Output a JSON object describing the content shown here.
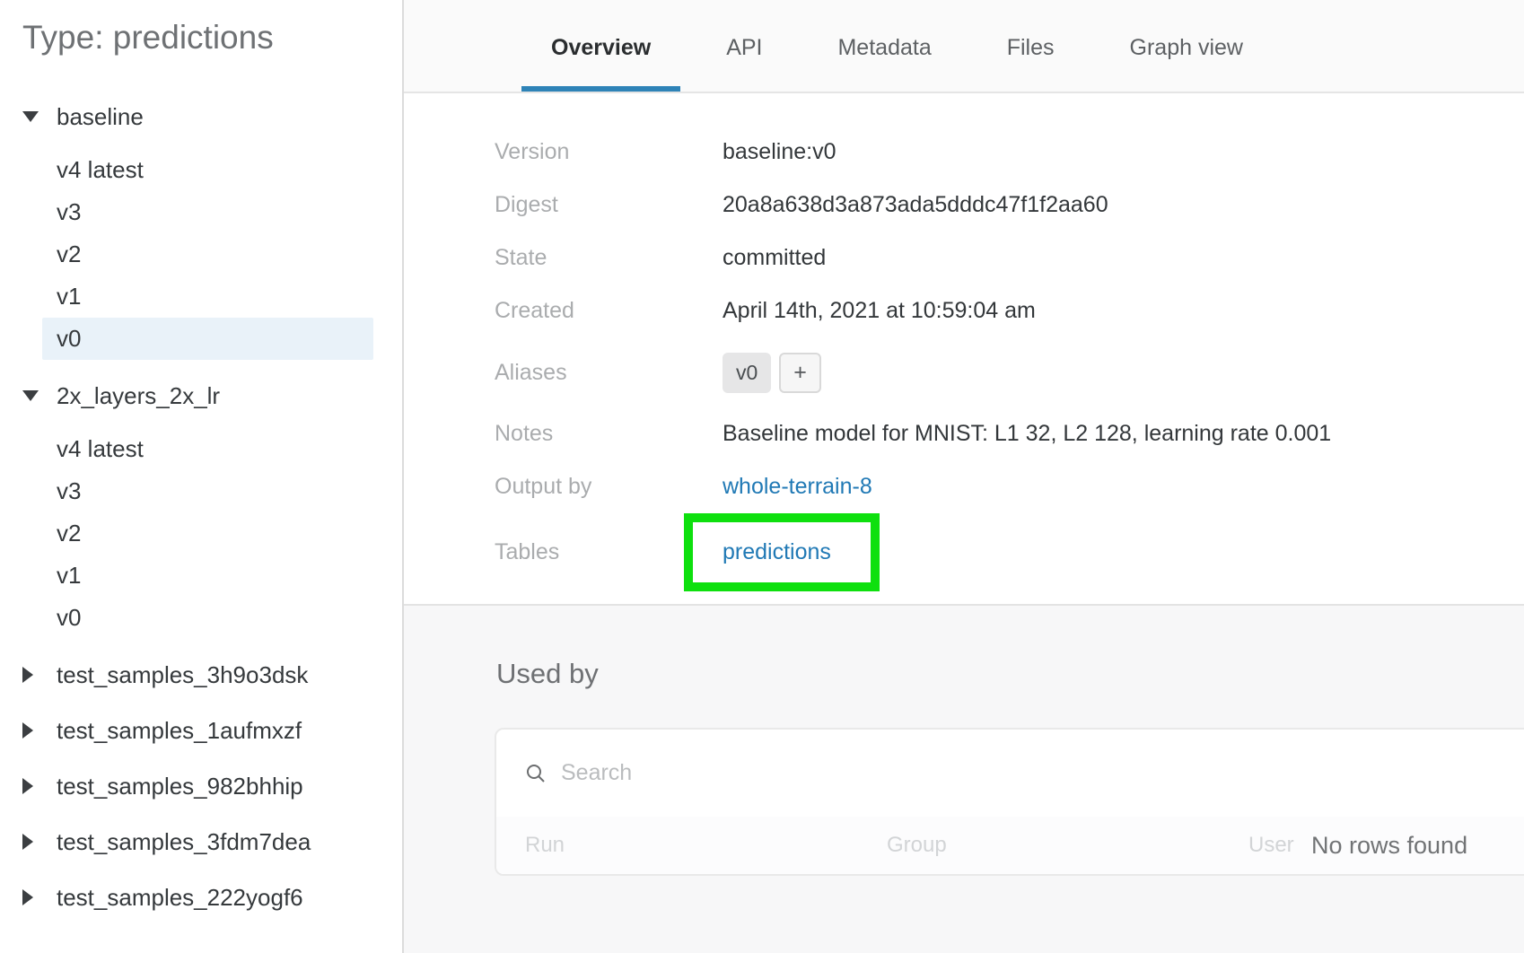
{
  "colors": {
    "accent_blue": "#2e83b7",
    "link_blue": "#2079b5",
    "highlight_green": "#0ee00e",
    "selected_row_bg": "#e9f2f9"
  },
  "sidebar": {
    "title": "Type: predictions",
    "tree": [
      {
        "type": "group",
        "label": "baseline",
        "expanded": true
      },
      {
        "type": "version",
        "label": "v4 latest",
        "selected": false
      },
      {
        "type": "version",
        "label": "v3",
        "selected": false
      },
      {
        "type": "version",
        "label": "v2",
        "selected": false
      },
      {
        "type": "version",
        "label": "v1",
        "selected": false
      },
      {
        "type": "version",
        "label": "v0",
        "selected": true
      },
      {
        "type": "group",
        "label": "2x_layers_2x_lr",
        "expanded": true
      },
      {
        "type": "version",
        "label": "v4 latest",
        "selected": false
      },
      {
        "type": "version",
        "label": "v3",
        "selected": false
      },
      {
        "type": "version",
        "label": "v2",
        "selected": false
      },
      {
        "type": "version",
        "label": "v1",
        "selected": false
      },
      {
        "type": "version",
        "label": "v0",
        "selected": false
      },
      {
        "type": "group",
        "label": "test_samples_3h9o3dsk",
        "expanded": false
      },
      {
        "type": "group",
        "label": "test_samples_1aufmxzf",
        "expanded": false
      },
      {
        "type": "group",
        "label": "test_samples_982bhhip",
        "expanded": false
      },
      {
        "type": "group",
        "label": "test_samples_3fdm7dea",
        "expanded": false
      },
      {
        "type": "group",
        "label": "test_samples_222yogf6",
        "expanded": false
      }
    ]
  },
  "tabs": {
    "items": [
      {
        "label": "Overview",
        "active": true
      },
      {
        "label": "API",
        "active": false
      },
      {
        "label": "Metadata",
        "active": false
      },
      {
        "label": "Files",
        "active": false
      },
      {
        "label": "Graph view",
        "active": false
      }
    ]
  },
  "overview": {
    "fields": [
      {
        "label": "Version",
        "type": "text",
        "value": "baseline:v0"
      },
      {
        "label": "Digest",
        "type": "text",
        "value": "20a8a638d3a873ada5dddc47f1f2aa60"
      },
      {
        "label": "State",
        "type": "text",
        "value": "committed"
      },
      {
        "label": "Created",
        "type": "text",
        "value": "April 14th, 2021 at 10:59:04 am"
      },
      {
        "label": "Aliases",
        "type": "aliases",
        "pills": [
          "v0"
        ],
        "add_label": "+"
      },
      {
        "label": "Notes",
        "type": "text",
        "value": "Baseline model for MNIST: L1 32, L2 128, learning rate 0.001"
      },
      {
        "label": "Output by",
        "type": "link",
        "value": "whole-terrain-8",
        "highlighted": false
      },
      {
        "label": "Tables",
        "type": "link",
        "value": "predictions",
        "highlighted": true
      }
    ]
  },
  "used_by": {
    "heading": "Used by",
    "search_placeholder": "Search",
    "columns": [
      "Run",
      "Group",
      "User"
    ],
    "empty_message": "No rows found"
  }
}
